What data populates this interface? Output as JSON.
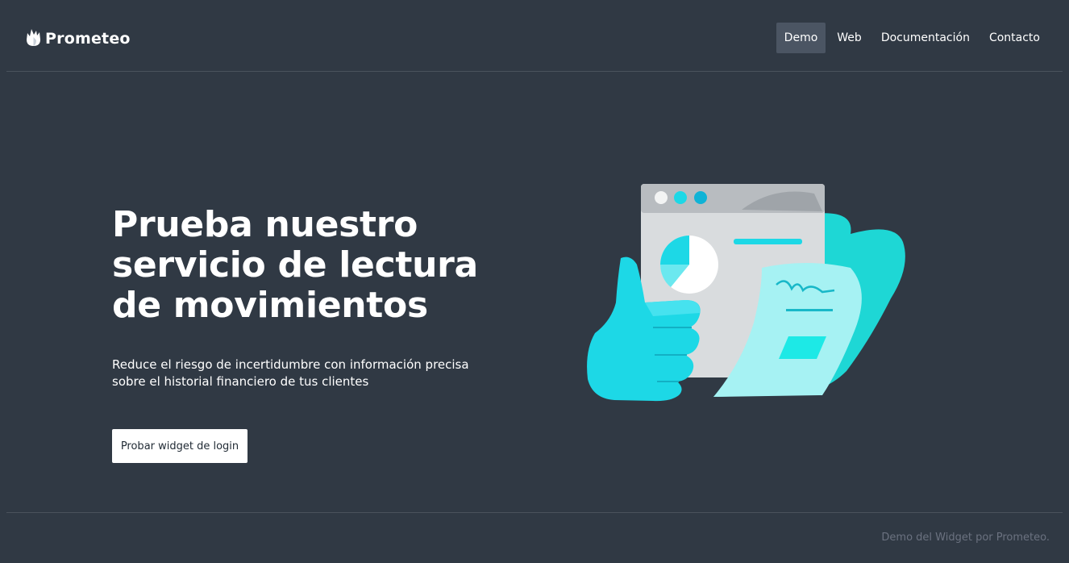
{
  "brand": {
    "name": "Prometeo",
    "logo_icon": "flame-logo-icon"
  },
  "nav": {
    "items": [
      {
        "label": "Demo",
        "active": true
      },
      {
        "label": "Web",
        "active": false
      },
      {
        "label": "Documentación",
        "active": false
      },
      {
        "label": "Contacto",
        "active": false
      }
    ]
  },
  "hero": {
    "title": "Prueba nuestro servicio de lectura de movimientos",
    "subtitle": "Reduce el riesgo de incertidumbre con información precisa sobre el historial financiero de tus clientes",
    "cta_label": "Probar widget de login",
    "illustration_icon": "thumbs-up-document-illustration"
  },
  "footer": {
    "text": "Demo del Widget por Prometeo."
  },
  "colors": {
    "background": "#303944",
    "accent": "#1de9e6",
    "nav_active": "#4b5563",
    "footer_text": "#6b7280"
  }
}
